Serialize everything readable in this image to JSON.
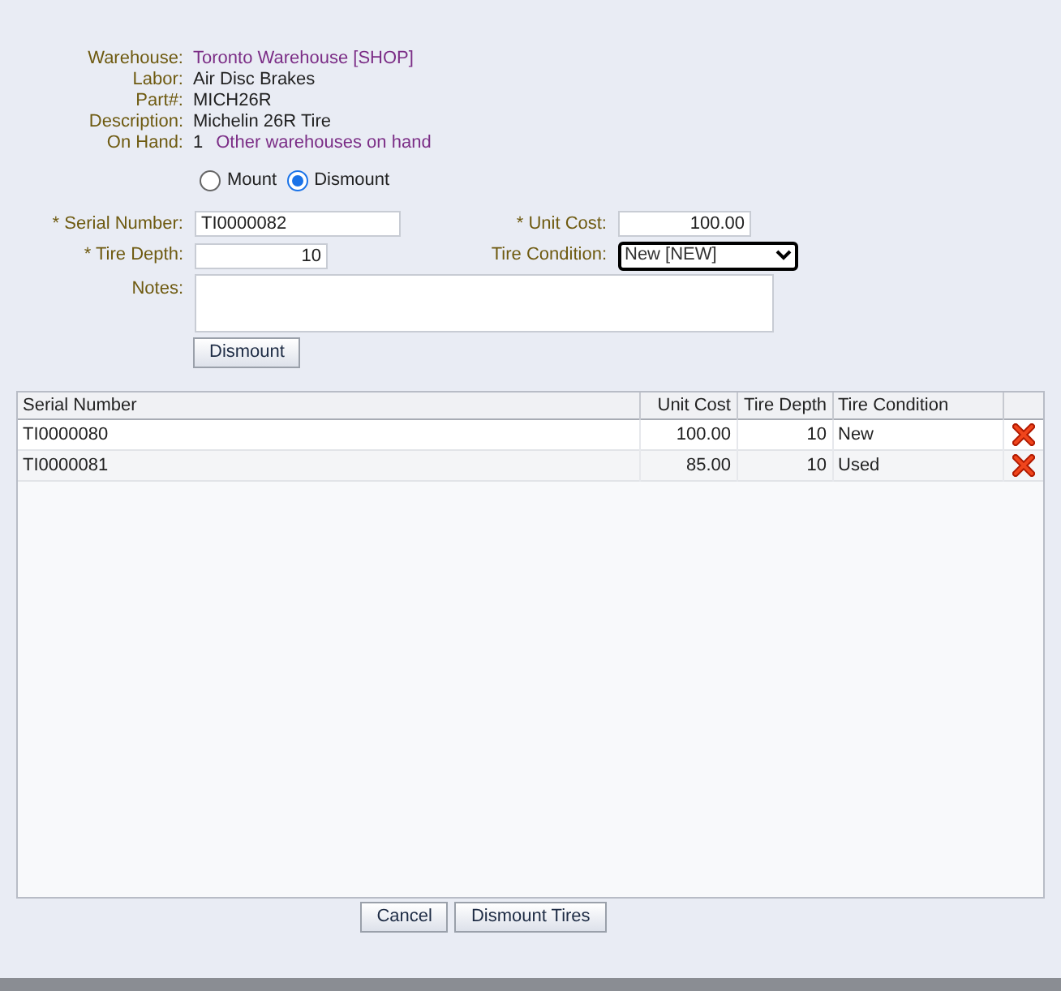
{
  "info": [
    {
      "label": "Warehouse:",
      "value": "Toronto Warehouse [SHOP]",
      "kind": "link"
    },
    {
      "label": "Labor:",
      "value": "Air Disc Brakes",
      "kind": "text"
    },
    {
      "label": "Part#:",
      "value": "MICH26R",
      "kind": "text"
    },
    {
      "label": "Description:",
      "value": "Michelin 26R Tire",
      "kind": "text"
    },
    {
      "label": "On Hand:",
      "value": "1",
      "link": "Other warehouses on hand",
      "kind": "count"
    }
  ],
  "modes": [
    {
      "label": "Mount",
      "selected": false
    },
    {
      "label": "Dismount",
      "selected": true
    }
  ],
  "form": {
    "serial_label": "* Serial Number:",
    "serial": "TI0000082",
    "cost_label": "* Unit Cost:",
    "cost": "100.00",
    "depth_label": "* Tire Depth:",
    "depth": "10",
    "condition_label": "Tire Condition:",
    "condition": "New [NEW]",
    "notes_label": "Notes:",
    "button": "Dismount"
  },
  "table": {
    "columns": [
      "Serial Number",
      "Unit Cost",
      "Tire Depth",
      "Tire Condition"
    ],
    "rows": [
      {
        "serial": "TI0000080",
        "cost": "100.00",
        "depth": "10",
        "condition": "New"
      },
      {
        "serial": "TI0000081",
        "cost": "85.00",
        "depth": "10",
        "condition": "Used"
      }
    ]
  },
  "buttons": [
    "Cancel",
    "Dismount Tires"
  ]
}
